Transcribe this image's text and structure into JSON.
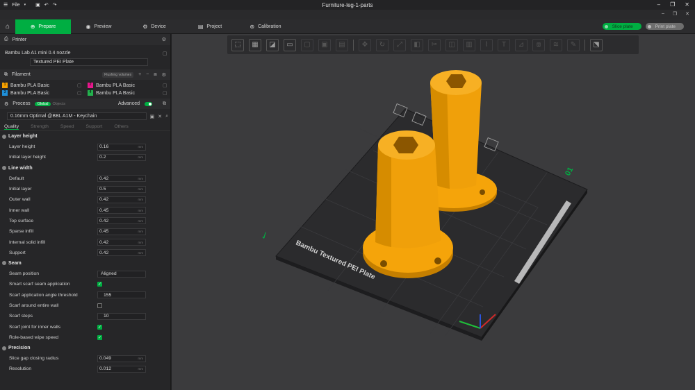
{
  "window": {
    "title": "Furniture-leg-1-parts",
    "menu_label": "File",
    "btn_minimize": "–",
    "btn_maximize": "❐",
    "btn_close": "✕"
  },
  "nav": {
    "home_icon": "home-icon",
    "tabs": [
      {
        "label": "Prepare",
        "icon": "prepare-icon"
      },
      {
        "label": "Preview",
        "icon": "preview-icon"
      },
      {
        "label": "Device",
        "icon": "device-icon"
      },
      {
        "label": "Project",
        "icon": "project-icon"
      },
      {
        "label": "Calibration",
        "icon": "calibration-icon"
      }
    ],
    "slice_label": "Slice plate",
    "print_label": "Print plate"
  },
  "printer": {
    "section_label": "Printer",
    "model": "Bambu Lab A1 mini 0.4 nozzle",
    "plate": "Textured PEI Plate"
  },
  "filament": {
    "section_label": "Filament",
    "flushing_label": "Flushing volumes",
    "slots": [
      {
        "num": "1",
        "name": "Bambu PLA Basic",
        "color": "#f4a000"
      },
      {
        "num": "2",
        "name": "Bambu PLA Basic",
        "color": "#e6178c"
      },
      {
        "num": "3",
        "name": "Bambu PLA Basic",
        "color": "#1f8fd8"
      },
      {
        "num": "4",
        "name": "Bambu PLA Basic",
        "color": "#23b14d"
      }
    ]
  },
  "process": {
    "section_label": "Process",
    "global_label": "Global",
    "objects_label": "Objects",
    "advanced_label": "Advanced",
    "preset": "0.16mm Optimal @BBL A1M - Keychain",
    "tabs": [
      "Quality",
      "Strength",
      "Speed",
      "Support",
      "Others"
    ]
  },
  "quality": {
    "layer_height": {
      "label": "Layer height",
      "rows": [
        {
          "label": "Layer height",
          "value": "0.16",
          "unit": "mm"
        },
        {
          "label": "Initial layer height",
          "value": "0.2",
          "unit": "mm"
        }
      ]
    },
    "line_width": {
      "label": "Line width",
      "rows": [
        {
          "label": "Default",
          "value": "0.42",
          "unit": "mm"
        },
        {
          "label": "Initial layer",
          "value": "0.5",
          "unit": "mm"
        },
        {
          "label": "Outer wall",
          "value": "0.42",
          "unit": "mm"
        },
        {
          "label": "Inner wall",
          "value": "0.45",
          "unit": "mm"
        },
        {
          "label": "Top surface",
          "value": "0.42",
          "unit": "mm"
        },
        {
          "label": "Sparse infill",
          "value": "0.45",
          "unit": "mm"
        },
        {
          "label": "Internal solid infill",
          "value": "0.42",
          "unit": "mm"
        },
        {
          "label": "Support",
          "value": "0.42",
          "unit": "mm"
        }
      ]
    },
    "seam": {
      "label": "Seam",
      "position_label": "Seam position",
      "position_value": "Aligned",
      "smart_scarf_label": "Smart scarf seam application",
      "angle_label": "Scarf application angle threshold",
      "angle_value": "155",
      "around_wall_label": "Scarf around entire wall",
      "steps_label": "Scarf steps",
      "steps_value": "10",
      "inner_walls_label": "Scarf joint for inner walls",
      "wipe_label": "Role-based wipe speed"
    },
    "precision": {
      "label": "Precision",
      "rows": [
        {
          "label": "Slice gap closing radius",
          "value": "0.049",
          "unit": "mm"
        },
        {
          "label": "Resolution",
          "value": "0.012",
          "unit": "mm"
        }
      ]
    }
  },
  "viewport": {
    "plate_text": "Bambu Textured PEI Plate",
    "plate_number": "01",
    "object_color": "#f5a40a",
    "bed_color": "#2a2a2c"
  }
}
